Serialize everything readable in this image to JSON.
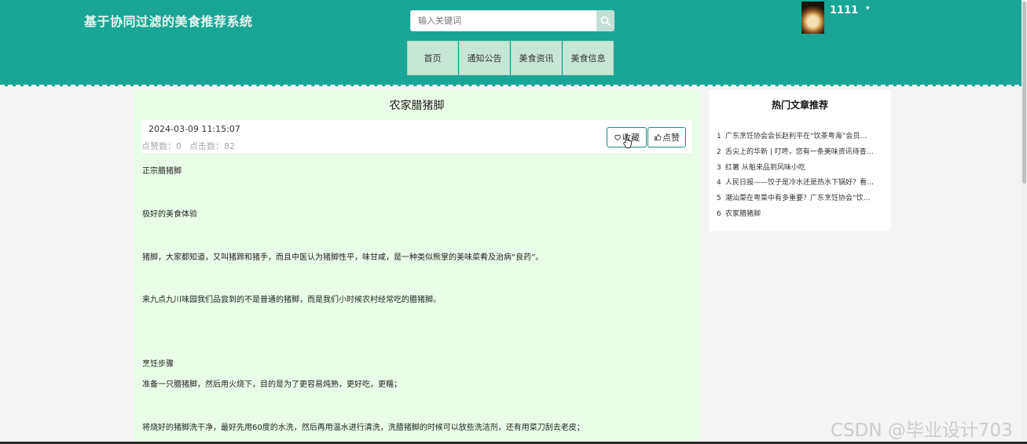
{
  "header": {
    "brand_title": "基于协同过滤的美食推荐系统",
    "search_placeholder": "输入关键词",
    "nav": [
      "首页",
      "通知公告",
      "美食资讯",
      "美食信息"
    ],
    "user_name": "1111",
    "user_caret": "▾"
  },
  "article": {
    "title": "农家腊猪脚",
    "date": "2024-03-09 11:15:07",
    "likes_text": "点赞数：0",
    "clicks_text": "点击数：82",
    "favorite_label": "收藏",
    "like_label": "点赞",
    "paragraphs": [
      "正宗腊猪脚",
      "极好的美食体验",
      "猪脚，大家都知道，又叫猪蹄和猪手，而且中医认为猪脚性平，味甘咸，是一种类似熊掌的美味菜肴及治病“良药”。",
      "来九点九川味园我们品尝到的不是普通的猪脚，而是我们小时候农村经常吃的腊猪脚。",
      "烹饪步骤",
      "准备一只腊猪脚，然后用火烧下，目的是为了更容易炖熟，更好吃，更糯；",
      "将烧好的猪脚洗干净，最好先用60度的水洗，然后再用温水进行清洗，洗腊猪脚的时候可以放些洗洁剂，还有用菜刀刮去老皮；"
    ]
  },
  "sidebar": {
    "title": "热门文章推荐",
    "items": [
      {
        "num": "1",
        "text": "广东烹饪协会会长赵利平在“饮茶粤海”会员…"
      },
      {
        "num": "2",
        "text": "舌尖上的华新 | 叮咚，您有一条美味资讯待查…"
      },
      {
        "num": "3",
        "text": "红薯 从舶来品到风味小吃"
      },
      {
        "num": "4",
        "text": "人民日报——饺子是冷水还是热水下锅好？看…"
      },
      {
        "num": "5",
        "text": "潮汕菜在粤菜中有多重要？广东烹饪协会“饮…"
      },
      {
        "num": "6",
        "text": "农家腊猪脚"
      }
    ]
  },
  "watermark": "CSDN @毕业设计703",
  "colors": {
    "header_bg": "#1aa697",
    "nav_bg": "#c6e7d6",
    "article_bg": "#e8fde8",
    "button_border": "#1a8f86"
  }
}
